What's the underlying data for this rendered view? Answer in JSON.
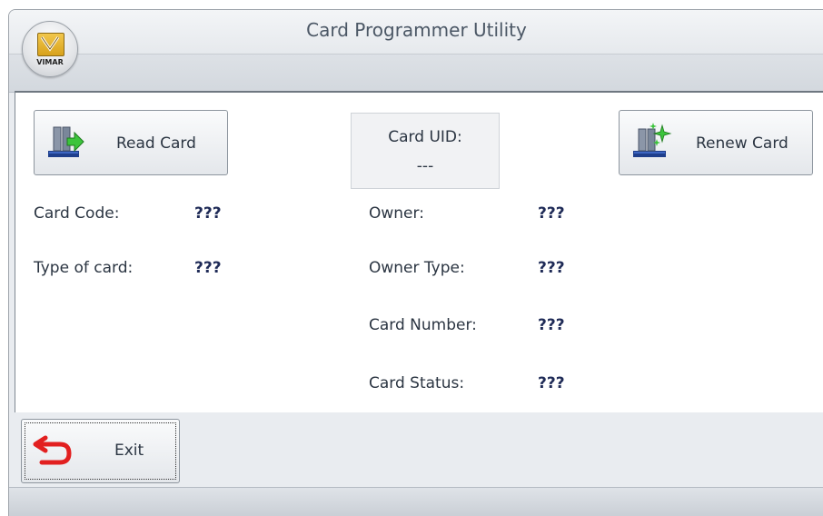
{
  "window": {
    "title": "Card Programmer Utility",
    "logo_text": "VIMAR"
  },
  "toolbar": {
    "read_card_label": "Read Card",
    "renew_card_label": "Renew Card"
  },
  "uid": {
    "label": "Card UID:",
    "value": "---"
  },
  "fields": {
    "card_code": {
      "label": "Card Code:",
      "value": "???"
    },
    "type_of_card": {
      "label": "Type of card:",
      "value": "???"
    },
    "owner": {
      "label": "Owner:",
      "value": "???"
    },
    "owner_type": {
      "label": "Owner Type:",
      "value": "???"
    },
    "card_number": {
      "label": "Card Number:",
      "value": "???"
    },
    "card_status": {
      "label": "Card Status:",
      "value": "???"
    }
  },
  "footer": {
    "exit_label": "Exit"
  },
  "icons": {
    "app_logo": "vimar-logo-icon",
    "read_card": "read-card-icon",
    "renew_card": "renew-card-icon",
    "exit": "exit-arrow-icon"
  },
  "colors": {
    "accent_green": "#3cc43c",
    "accent_blue": "#1f3f8c",
    "exit_red": "#e22020",
    "value_text": "#1f2b57"
  }
}
